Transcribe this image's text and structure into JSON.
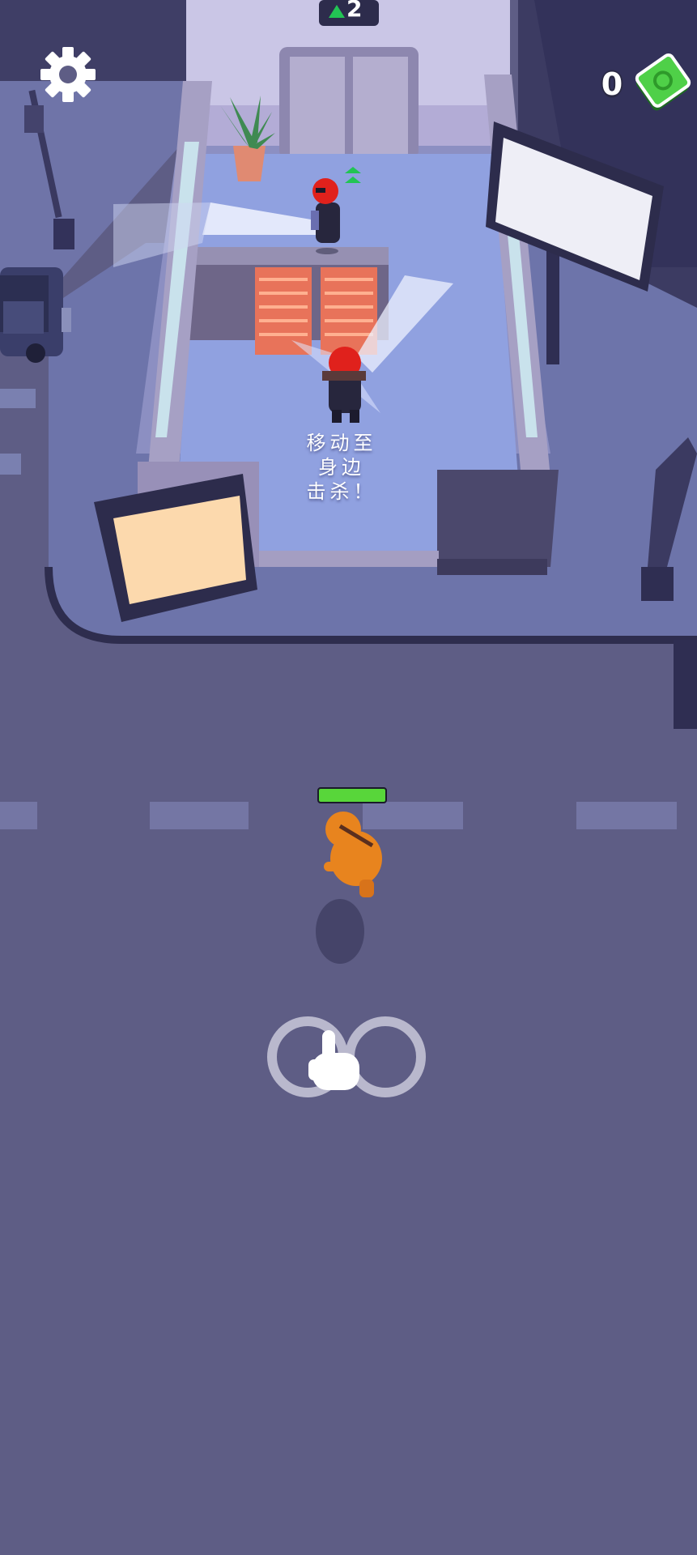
{
  "hud": {
    "money": "0",
    "floor": "2",
    "settings_icon": "gear-icon",
    "cash_icon": "cash-icon"
  },
  "instruction": {
    "lines": [
      "移动至",
      "身边",
      "击杀！"
    ]
  },
  "player": {
    "health_fraction": 1.0
  },
  "tutorial": {
    "icon": "swipe-hand-icon"
  },
  "colors": {
    "player": "#e8841e",
    "enemy_head": "#e0211c",
    "health": "#58d63a",
    "street": "#5e5d85",
    "floor": "#90a1e0"
  }
}
